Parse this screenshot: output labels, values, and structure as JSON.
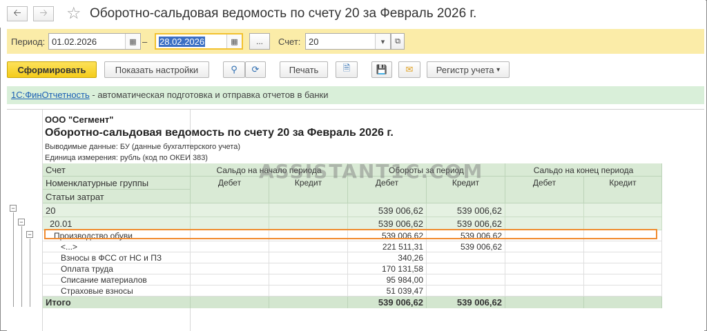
{
  "window": {
    "title": "Оборотно-сальдовая ведомость по счету 20 за Февраль 2026 г.",
    "back_icon": "arrow-left-icon",
    "forward_icon": "arrow-right-icon",
    "favorite_icon": "star-icon"
  },
  "period": {
    "label": "Период:",
    "from": "01.02.2026",
    "dash": "–",
    "to": "28.02.2026",
    "more_label": "...",
    "account_label": "Счет:",
    "account_value": "20"
  },
  "toolbar": {
    "generate_label": "Сформировать",
    "settings_label": "Показать настройки",
    "print_label": "Печать",
    "register_label": "Регистр учета"
  },
  "info": {
    "link": "1С:ФинОтчетность",
    "text": " - автоматическая подготовка и отправка отчетов в банки"
  },
  "report": {
    "company": "ООО \"Сегмент\"",
    "title": "Оборотно-сальдовая ведомость по счету 20 за Февраль 2026 г.",
    "output_data": "Выводимые данные: БУ (данные бухгалтерского учета)",
    "unit": "Единица измерения: рубль (код по ОКЕИ 383)",
    "headers": {
      "account": "Счет",
      "nomenclature": "Номенклатурные группы",
      "cost_items": "Статьи затрат",
      "opening_balance": "Сальдо на начало периода",
      "turnover": "Обороты за период",
      "closing_balance": "Сальдо на конец периода",
      "debit": "Дебет",
      "credit": "Кредит"
    },
    "rows": [
      {
        "name": "20",
        "turn_debit": "539 006,62",
        "turn_credit": "539 006,62"
      },
      {
        "name": "20.01",
        "turn_debit": "539 006,62",
        "turn_credit": "539 006,62"
      },
      {
        "name": "Производство обуви",
        "turn_debit": "539 006,62",
        "turn_credit": "539 006,62"
      },
      {
        "name": "<...>",
        "turn_debit": "221 511,31",
        "turn_credit": "539 006,62"
      },
      {
        "name": "Взносы в ФСС от НС и ПЗ",
        "turn_debit": "340,26",
        "turn_credit": ""
      },
      {
        "name": "Оплата труда",
        "turn_debit": "170 131,58",
        "turn_credit": ""
      },
      {
        "name": "Списание материалов",
        "turn_debit": "95 984,00",
        "turn_credit": ""
      },
      {
        "name": "Страховые взносы",
        "turn_debit": "51 039,47",
        "turn_credit": ""
      }
    ],
    "total": {
      "name": "Итого",
      "turn_debit": "539 006,62",
      "turn_credit": "539 006,62"
    }
  },
  "watermark": "ASSISTANT1C.COM"
}
